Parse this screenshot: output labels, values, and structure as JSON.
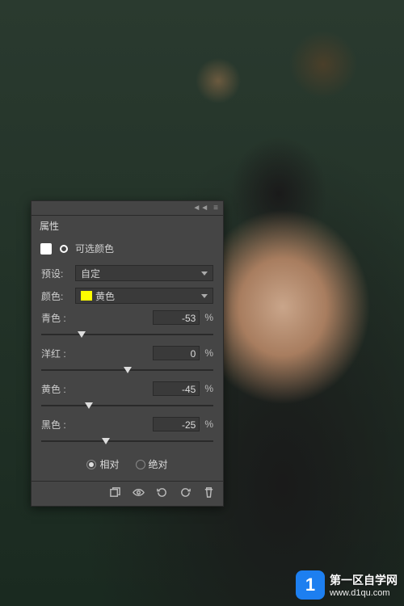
{
  "panel": {
    "tab_title": "属性",
    "adjustment_label": "可选颜色",
    "preset_label": "预设:",
    "preset_value": "自定",
    "color_label": "颜色:",
    "color_value": "黄色",
    "color_swatch": "#ffff00",
    "sliders": [
      {
        "label": "青色 :",
        "value": "-53",
        "pct": 23.5,
        "unit": "%"
      },
      {
        "label": "洋红 :",
        "value": "0",
        "pct": 50,
        "unit": "%"
      },
      {
        "label": "黄色 :",
        "value": "-45",
        "pct": 27.5,
        "unit": "%"
      },
      {
        "label": "黑色 :",
        "value": "-25",
        "pct": 37.5,
        "unit": "%"
      }
    ],
    "method": {
      "relative": "相对",
      "absolute": "绝对",
      "selected": "relative"
    }
  },
  "watermark": {
    "logo": "1",
    "text": "第一区自学网",
    "url": "www.d1qu.com"
  }
}
